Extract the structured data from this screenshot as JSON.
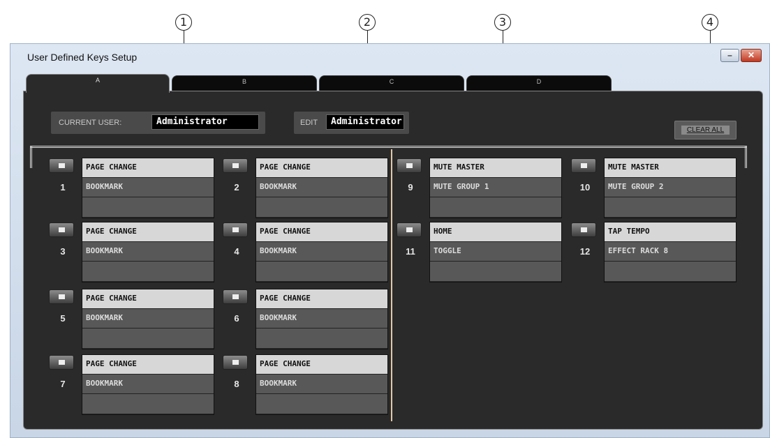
{
  "callouts": [
    "1",
    "2",
    "3",
    "4"
  ],
  "window": {
    "title": "User Defined Keys Setup",
    "minimize_glyph": "–",
    "close_glyph": "✕"
  },
  "tabs": [
    "A",
    "B",
    "C",
    "D"
  ],
  "current_user": {
    "label": "CURRENT USER:",
    "value": "Administrator"
  },
  "edit_user": {
    "label": "EDIT",
    "value": "Administrator"
  },
  "clear_all": "CLEAR ALL",
  "keys": [
    {
      "number": "1",
      "line1": "PAGE CHANGE",
      "line2": "BOOKMARK",
      "line3": ""
    },
    {
      "number": "2",
      "line1": "PAGE CHANGE",
      "line2": "BOOKMARK",
      "line3": ""
    },
    {
      "number": "3",
      "line1": "PAGE CHANGE",
      "line2": "BOOKMARK",
      "line3": ""
    },
    {
      "number": "4",
      "line1": "PAGE CHANGE",
      "line2": "BOOKMARK",
      "line3": ""
    },
    {
      "number": "5",
      "line1": "PAGE CHANGE",
      "line2": "BOOKMARK",
      "line3": ""
    },
    {
      "number": "6",
      "line1": "PAGE CHANGE",
      "line2": "BOOKMARK",
      "line3": ""
    },
    {
      "number": "7",
      "line1": "PAGE CHANGE",
      "line2": "BOOKMARK",
      "line3": ""
    },
    {
      "number": "8",
      "line1": "PAGE CHANGE",
      "line2": "BOOKMARK",
      "line3": ""
    },
    {
      "number": "9",
      "line1": "MUTE MASTER",
      "line2": "MUTE GROUP 1",
      "line3": ""
    },
    {
      "number": "10",
      "line1": "MUTE MASTER",
      "line2": "MUTE GROUP 2",
      "line3": ""
    },
    {
      "number": "11",
      "line1": "HOME",
      "line2": "TOGGLE",
      "line3": ""
    },
    {
      "number": "12",
      "line1": "TAP TEMPO",
      "line2": "EFFECT RACK 8",
      "line3": ""
    }
  ],
  "colors": {
    "panel_bg": "#2a2a2a",
    "field_active": "#d7d7d7",
    "field_inactive": "#585858",
    "divider": "#e2c9a8"
  }
}
